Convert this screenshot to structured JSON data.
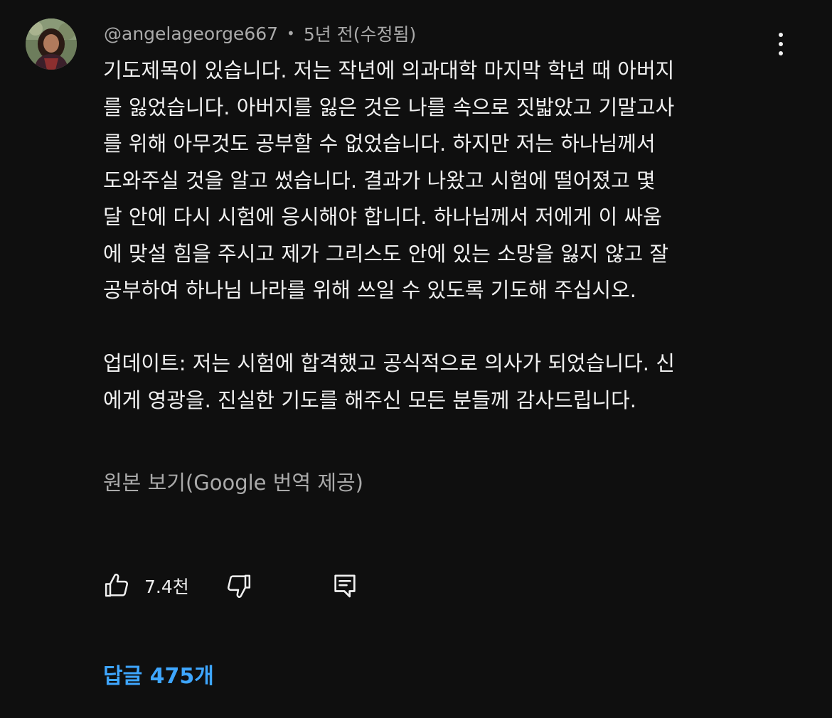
{
  "comment": {
    "author": "@angelageorge667",
    "separator": "•",
    "time": "5년 전(수정됨)",
    "body_lines": [
      "기도제목이 있습니다. 저는 작년에 의과대학 마지막 학년 때 아버지",
      "를 잃었습니다. 아버지를 잃은 것은 나를 속으로 짓밟았고 기말고사",
      "를 위해 아무것도 공부할 수 없었습니다. 하지만 저는 하나님께서",
      "도와주실 것을 알고 썼습니다. 결과가 나왔고 시험에 떨어졌고 몇",
      "달 안에 다시 시험에 응시해야 합니다. 하나님께서 저에게 이 싸움",
      "에 맞설 힘을 주시고 제가 그리스도 안에 있는 소망을 잃지 않고 잘",
      "공부하여 하나님 나라를 위해 쓰일 수 있도록 기도해 주십시오."
    ],
    "update_lines": [
      "업데이트: 저는 시험에 합격했고 공식적으로 의사가 되었습니다. 신",
      "에게 영광을. 진실한 기도를 해주신 모든 분들께 감사드립니다."
    ],
    "translate_label": "원본 보기(Google 번역 제공)",
    "like_count": "7.4천",
    "replies_label": "답글 475개"
  },
  "icons": {
    "menu": "more-vert-icon",
    "like": "thumb-up-icon",
    "dislike": "thumb-down-icon",
    "reply": "comment-icon"
  },
  "colors": {
    "background": "#0f0f0f",
    "text": "#f1f1f1",
    "secondary_text": "#aaaaaa",
    "link": "#3ea6ff"
  }
}
